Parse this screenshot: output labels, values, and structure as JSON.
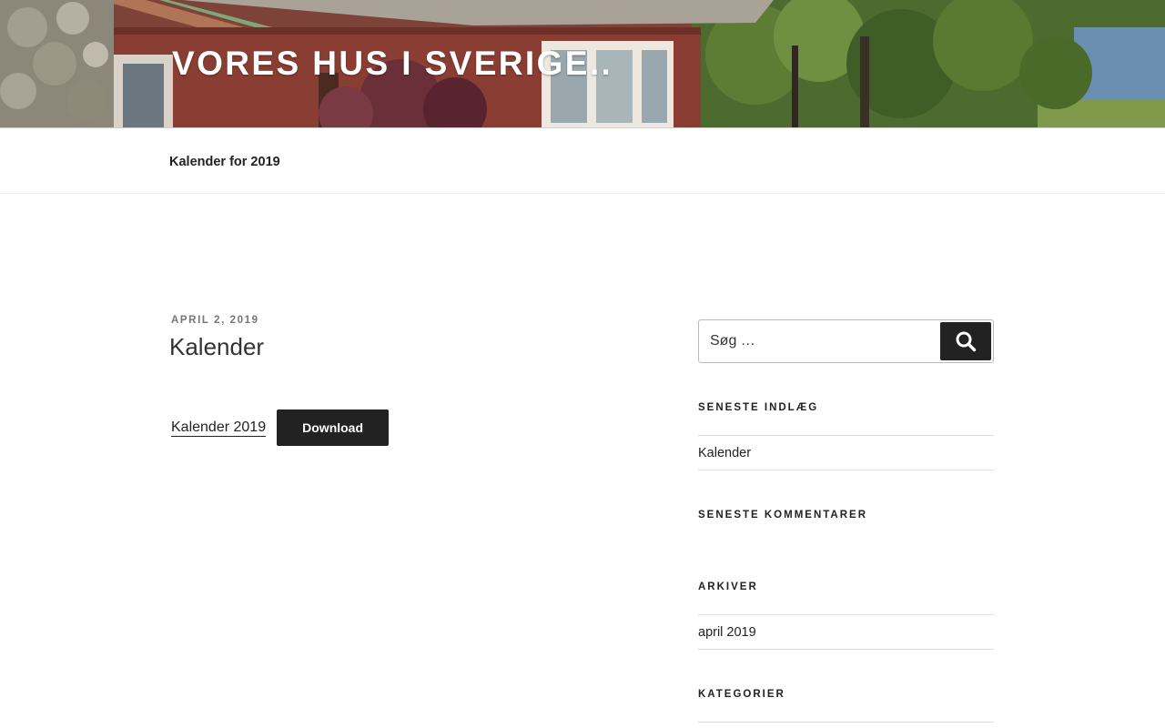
{
  "header": {
    "site_title": "VORES HUS I SVERIGE.."
  },
  "nav": {
    "items": [
      {
        "label": "Kalender for 2019"
      }
    ]
  },
  "post": {
    "date": "APRIL 2, 2019",
    "title": "Kalender",
    "file_link": "Kalender 2019",
    "download_label": "Download"
  },
  "sidebar": {
    "search": {
      "placeholder": "Søg …",
      "button_icon": "search-icon"
    },
    "recent_posts": {
      "title": "SENESTE INDLÆG",
      "items": [
        "Kalender"
      ]
    },
    "recent_comments": {
      "title": "SENESTE KOMMENTARER"
    },
    "archives": {
      "title": "ARKIVER",
      "items": [
        "april 2019"
      ]
    },
    "categories": {
      "title": "KATEGORIER"
    }
  },
  "colors": {
    "button_bg": "#222222",
    "text": "#222222",
    "date": "#767676"
  }
}
